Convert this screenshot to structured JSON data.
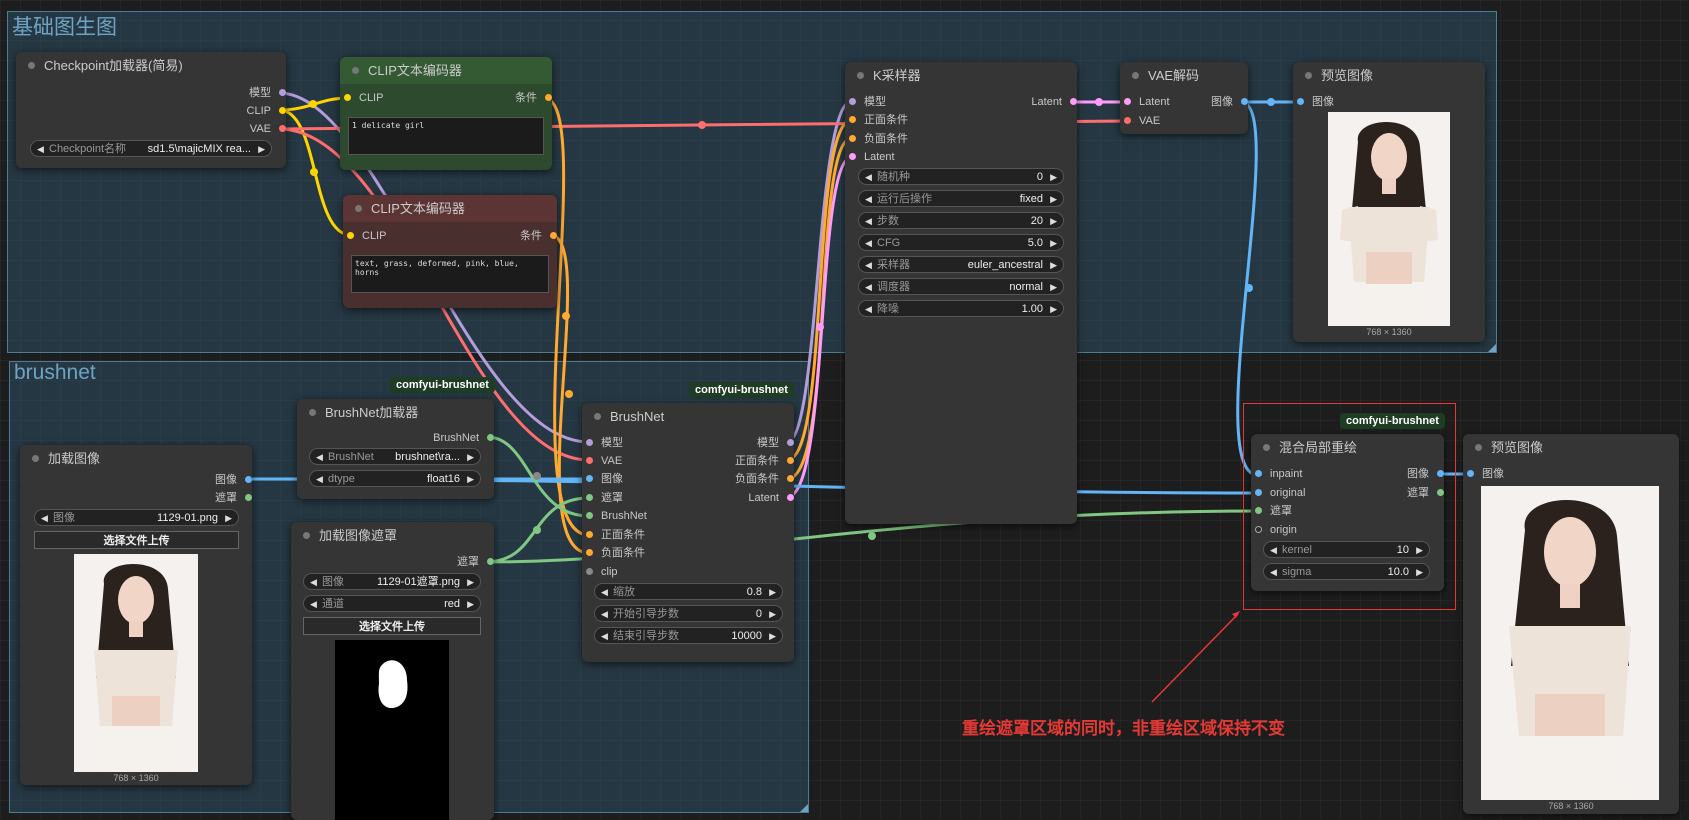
{
  "colors": {
    "model": "#b39ddb",
    "clip": "#ffd500",
    "vae": "#ff6e6e",
    "conditioning": "#ffa931",
    "latent": "#ff9cf9",
    "image": "#64b5f6",
    "mask": "#81c784",
    "brushnet": "#81c784",
    "annotation": "#e53935"
  },
  "groups": {
    "basic": "基础图生图",
    "brushnet": "brushnet"
  },
  "badges": {
    "brushnet_loader": "comfyui-brushnet",
    "brushnet_node": "comfyui-brushnet",
    "blend": "comfyui-brushnet"
  },
  "checkpoint": {
    "title": "Checkpoint加载器(简易)",
    "out_model": "模型",
    "out_clip": "CLIP",
    "out_vae": "VAE",
    "w_label": "Checkpoint名称",
    "w_value": "sd1.5\\majicMIX rea..."
  },
  "clip_pos": {
    "title": "CLIP文本编码器",
    "in_clip": "CLIP",
    "out": "条件",
    "text": "1 delicate girl"
  },
  "clip_neg": {
    "title": "CLIP文本编码器",
    "in_clip": "CLIP",
    "out": "条件",
    "text": "text, grass, deformed, pink, blue, horns"
  },
  "ksampler": {
    "title": "K采样器",
    "in_model": "模型",
    "in_pos": "正面条件",
    "in_neg": "负面条件",
    "in_latent": "Latent",
    "out_latent": "Latent",
    "widgets": [
      {
        "label": "随机种",
        "value": "0"
      },
      {
        "label": "运行后操作",
        "value": "fixed"
      },
      {
        "label": "步数",
        "value": "20"
      },
      {
        "label": "CFG",
        "value": "5.0"
      },
      {
        "label": "采样器",
        "value": "euler_ancestral"
      },
      {
        "label": "调度器",
        "value": "normal"
      },
      {
        "label": "降噪",
        "value": "1.00"
      }
    ]
  },
  "vae_decode": {
    "title": "VAE解码",
    "in_latent": "Latent",
    "in_vae": "VAE",
    "out_image": "图像"
  },
  "preview1": {
    "title": "预览图像",
    "in_image": "图像",
    "dims": "768 × 1360"
  },
  "load_image": {
    "title": "加载图像",
    "out_image": "图像",
    "out_mask": "遮罩",
    "w_label": "图像",
    "w_value": "1129-01.png",
    "upload": "选择文件上传",
    "dims": "768 × 1360"
  },
  "brushnet_loader": {
    "title": "BrushNet加载器",
    "out": "BrushNet",
    "w1_label": "BrushNet",
    "w1_value": "brushnet\\ra...",
    "w2_label": "dtype",
    "w2_value": "float16"
  },
  "load_mask": {
    "title": "加载图像遮罩",
    "out_mask": "遮罩",
    "w1_label": "图像",
    "w1_value": "1129-01遮罩.png",
    "w2_label": "通道",
    "w2_value": "red",
    "upload": "选择文件上传"
  },
  "brushnet": {
    "title": "BrushNet",
    "in_model": "模型",
    "in_vae": "VAE",
    "in_image": "图像",
    "in_mask": "遮罩",
    "in_brushnet": "BrushNet",
    "in_pos": "正面条件",
    "in_neg": "负面条件",
    "in_clip": "clip",
    "out_model": "模型",
    "out_pos": "正面条件",
    "out_neg": "负面条件",
    "out_latent": "Latent",
    "widgets": [
      {
        "label": "缩放",
        "value": "0.8"
      },
      {
        "label": "开始引导步数",
        "value": "0"
      },
      {
        "label": "结束引导步数",
        "value": "10000"
      }
    ]
  },
  "blend": {
    "title": "混合局部重绘",
    "in_inpaint": "inpaint",
    "in_original": "original",
    "in_mask": "遮罩",
    "in_origin": "origin",
    "out_image": "图像",
    "out_mask": "遮罩",
    "widgets": [
      {
        "label": "kernel",
        "value": "10"
      },
      {
        "label": "sigma",
        "value": "10.0"
      }
    ]
  },
  "preview2": {
    "title": "预览图像",
    "in_image": "图像",
    "dims": "768 × 1360"
  },
  "annotation": "重绘遮罩区域的同时，非重绘区域保持不变"
}
